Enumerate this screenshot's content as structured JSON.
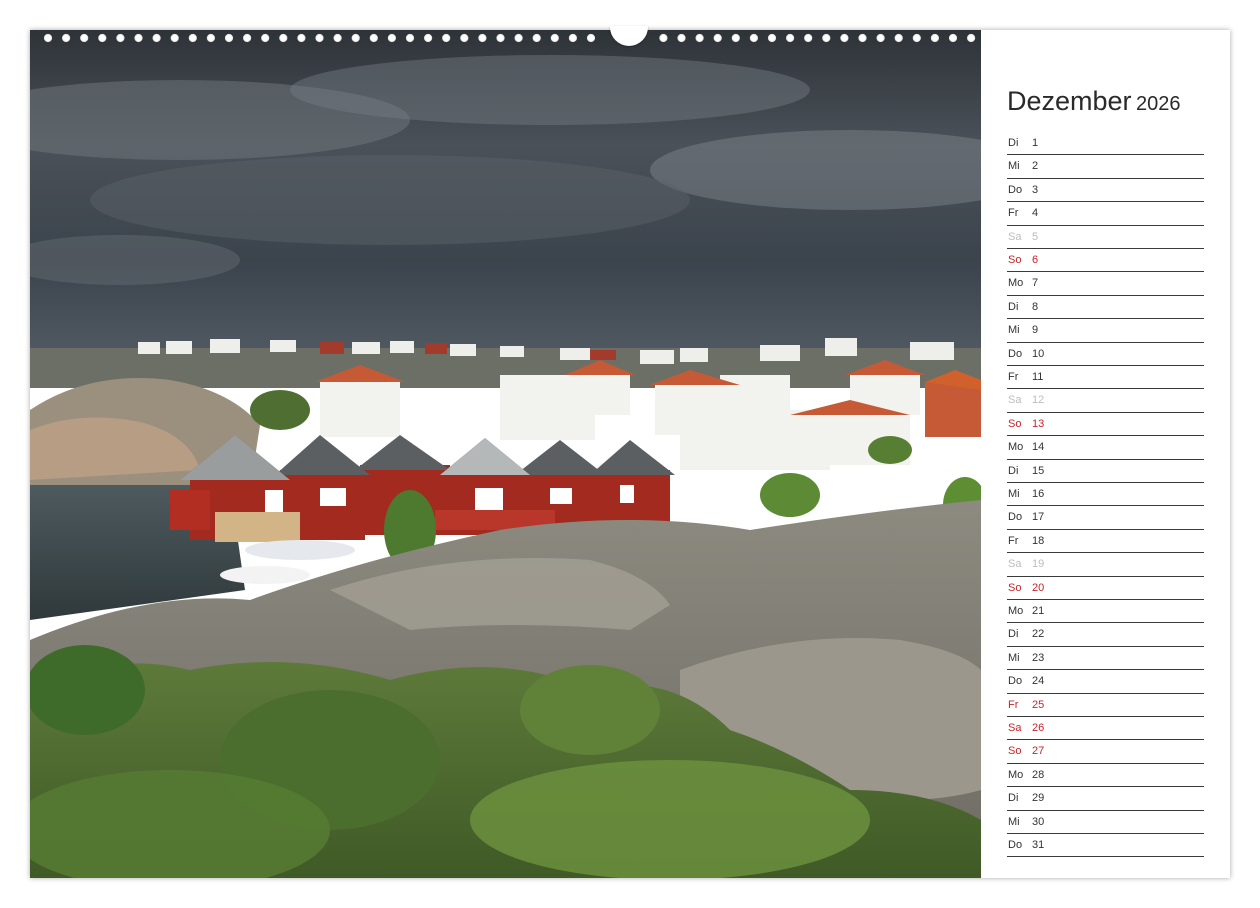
{
  "calendar": {
    "month": "Dezember",
    "year": "2026",
    "days": [
      {
        "dow": "Di",
        "num": "1",
        "type": "weekday"
      },
      {
        "dow": "Mi",
        "num": "2",
        "type": "weekday"
      },
      {
        "dow": "Do",
        "num": "3",
        "type": "weekday"
      },
      {
        "dow": "Fr",
        "num": "4",
        "type": "weekday"
      },
      {
        "dow": "Sa",
        "num": "5",
        "type": "saturday"
      },
      {
        "dow": "So",
        "num": "6",
        "type": "sunday"
      },
      {
        "dow": "Mo",
        "num": "7",
        "type": "weekday"
      },
      {
        "dow": "Di",
        "num": "8",
        "type": "weekday"
      },
      {
        "dow": "Mi",
        "num": "9",
        "type": "weekday"
      },
      {
        "dow": "Do",
        "num": "10",
        "type": "weekday"
      },
      {
        "dow": "Fr",
        "num": "11",
        "type": "weekday"
      },
      {
        "dow": "Sa",
        "num": "12",
        "type": "saturday"
      },
      {
        "dow": "So",
        "num": "13",
        "type": "sunday"
      },
      {
        "dow": "Mo",
        "num": "14",
        "type": "weekday"
      },
      {
        "dow": "Di",
        "num": "15",
        "type": "weekday"
      },
      {
        "dow": "Mi",
        "num": "16",
        "type": "weekday"
      },
      {
        "dow": "Do",
        "num": "17",
        "type": "weekday"
      },
      {
        "dow": "Fr",
        "num": "18",
        "type": "weekday"
      },
      {
        "dow": "Sa",
        "num": "19",
        "type": "saturday"
      },
      {
        "dow": "So",
        "num": "20",
        "type": "sunday"
      },
      {
        "dow": "Mo",
        "num": "21",
        "type": "weekday"
      },
      {
        "dow": "Di",
        "num": "22",
        "type": "weekday"
      },
      {
        "dow": "Mi",
        "num": "23",
        "type": "weekday"
      },
      {
        "dow": "Do",
        "num": "24",
        "type": "weekday"
      },
      {
        "dow": "Fr",
        "num": "25",
        "type": "holiday"
      },
      {
        "dow": "Sa",
        "num": "26",
        "type": "holiday"
      },
      {
        "dow": "So",
        "num": "27",
        "type": "sunday"
      },
      {
        "dow": "Mo",
        "num": "28",
        "type": "weekday"
      },
      {
        "dow": "Di",
        "num": "29",
        "type": "weekday"
      },
      {
        "dow": "Mi",
        "num": "30",
        "type": "weekday"
      },
      {
        "dow": "Do",
        "num": "31",
        "type": "weekday"
      }
    ]
  },
  "colors": {
    "holiday_red": "#c8242b",
    "saturday_grey": "#bdbdbd",
    "text_dark": "#333333"
  },
  "photo": {
    "icon": "landscape-photo"
  }
}
